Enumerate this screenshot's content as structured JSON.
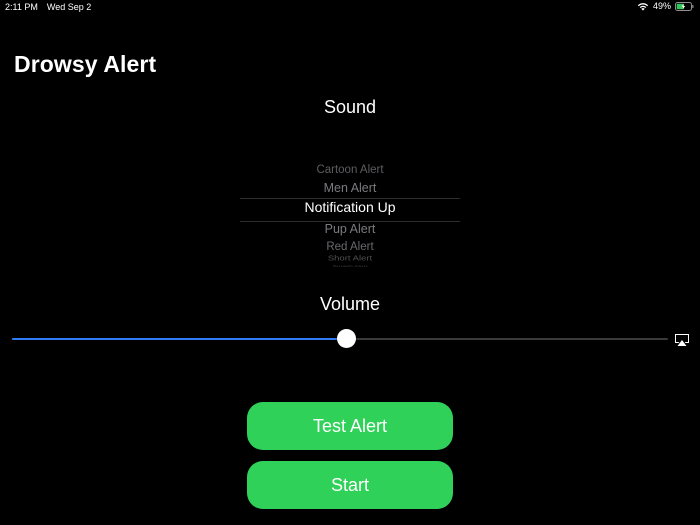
{
  "status_bar": {
    "time": "2:11 PM",
    "date": "Wed Sep 2",
    "battery_percent": "49%",
    "battery_level": 0.49,
    "wifi_icon": "wifi-icon",
    "battery_icon": "battery-icon"
  },
  "app": {
    "title": "Drowsy Alert"
  },
  "sound": {
    "label": "Sound",
    "options": [
      "Cartoon Alert",
      "Men Alert",
      "Notification Up",
      "Pup Alert",
      "Red Alert",
      "Short Alert",
      "Smash Alert"
    ],
    "selected_index": 2,
    "selected": "Notification Up"
  },
  "volume": {
    "label": "Volume",
    "level": 0.51,
    "accent_color": "#2f7cf6",
    "airplay_icon": "airplay-icon"
  },
  "buttons": {
    "test_alert": "Test Alert",
    "start": "Start",
    "color": "#30d158"
  }
}
